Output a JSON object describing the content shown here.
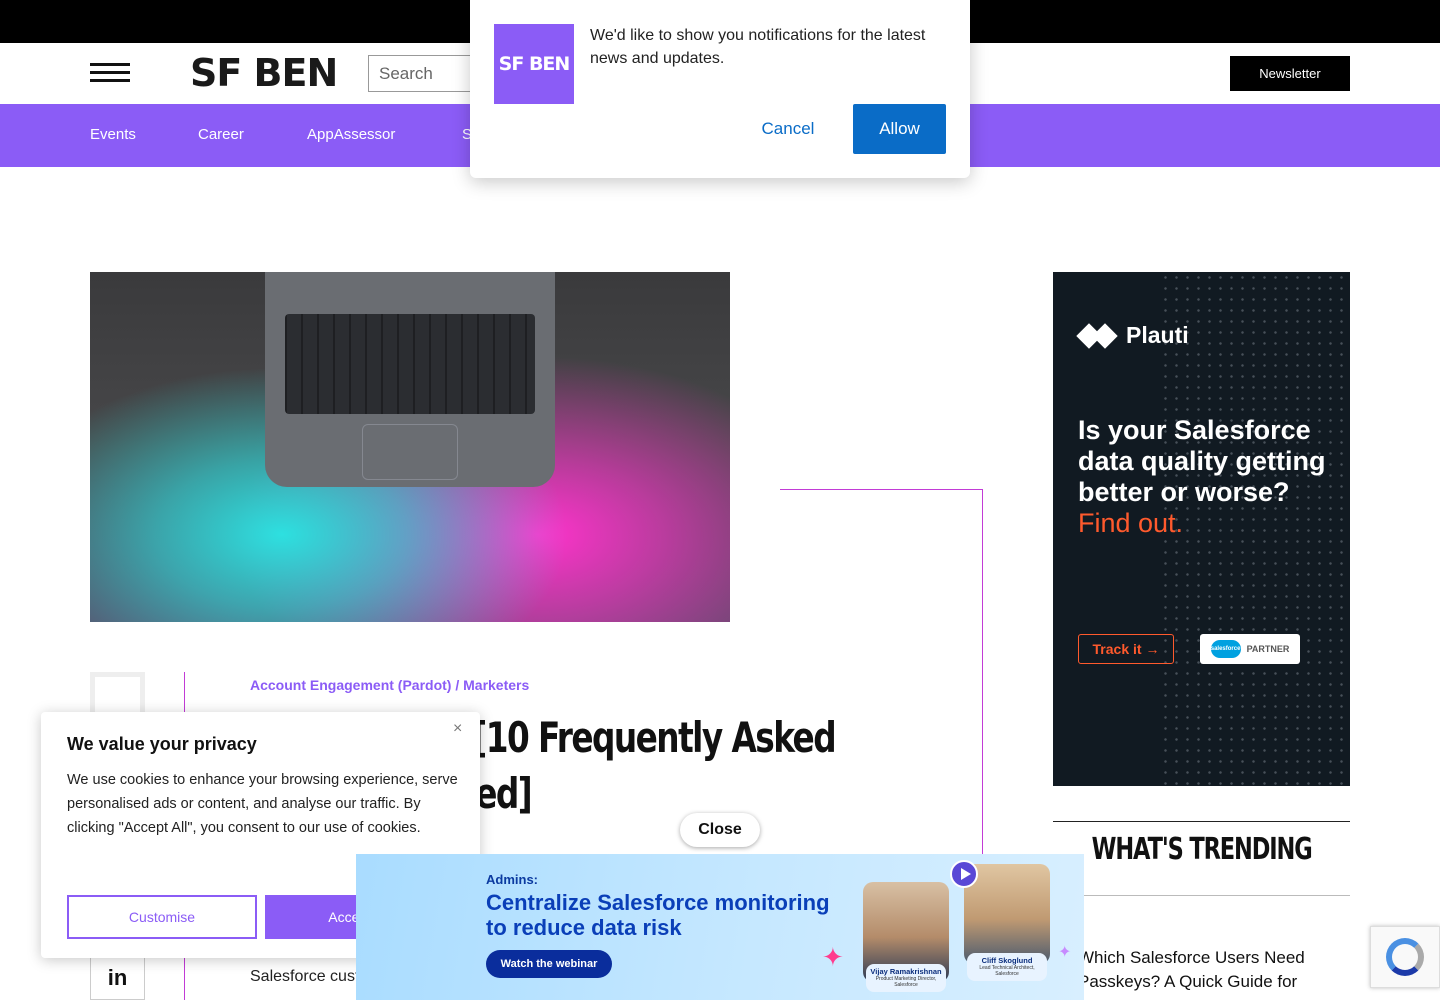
{
  "header": {
    "logo_text": "SF BEN",
    "search_placeholder": "Search",
    "newsletter_label": "Newsletter"
  },
  "nav": {
    "items": [
      "Events",
      "Career",
      "AppAssessor",
      "S"
    ]
  },
  "article": {
    "category": "Account Engagement (Pardot) / Marketers",
    "headline_visible": "P [10 Frequently Asked\nered]",
    "body_visible": "Salesforce cust"
  },
  "ad": {
    "brand": "Plauti",
    "headline": "Is your Salesforce data quality getting better or worse?",
    "cta_text": "Find out.",
    "button_label": "Track it →",
    "partner_logo_text": "salesforce",
    "partner_label": "PARTNER"
  },
  "trending": {
    "title": "WHAT'S TRENDING",
    "first_item": "Which Salesforce Users Need Passkeys? A Quick Guide for"
  },
  "notification": {
    "logo_text": "SF BEN",
    "message": "We'd like to show you notifications for the latest news and updates.",
    "cancel_label": "Cancel",
    "allow_label": "Allow"
  },
  "cookie": {
    "close_symbol": "×",
    "title": "We value your privacy",
    "body": "We use cookies to enhance your browsing experience, serve personalised ads or content, and analyse our traffic. By clicking \"Accept All\", you consent to our use of cookies.",
    "customise_label": "Customise",
    "accept_label": "Accept All"
  },
  "bottom_ad": {
    "close_label": "Close",
    "eyebrow": "Admins:",
    "title": "Centralize Salesforce monitoring to reduce data risk",
    "cta": "Watch the webinar",
    "speaker_1_name": "Vijay Ramakrishnan",
    "speaker_1_role": "Product Marketing Director, Salesforce",
    "speaker_2_name": "Cliff Skoglund",
    "speaker_2_role": "Lead Technical Architect, Salesforce"
  },
  "social": {
    "linkedin_label": "in"
  },
  "colors": {
    "brand_purple": "#8b5cf6",
    "accent_orange": "#ff5a2d",
    "allow_blue": "#0a6cc7",
    "deco_magenta": "#c23bd6"
  }
}
